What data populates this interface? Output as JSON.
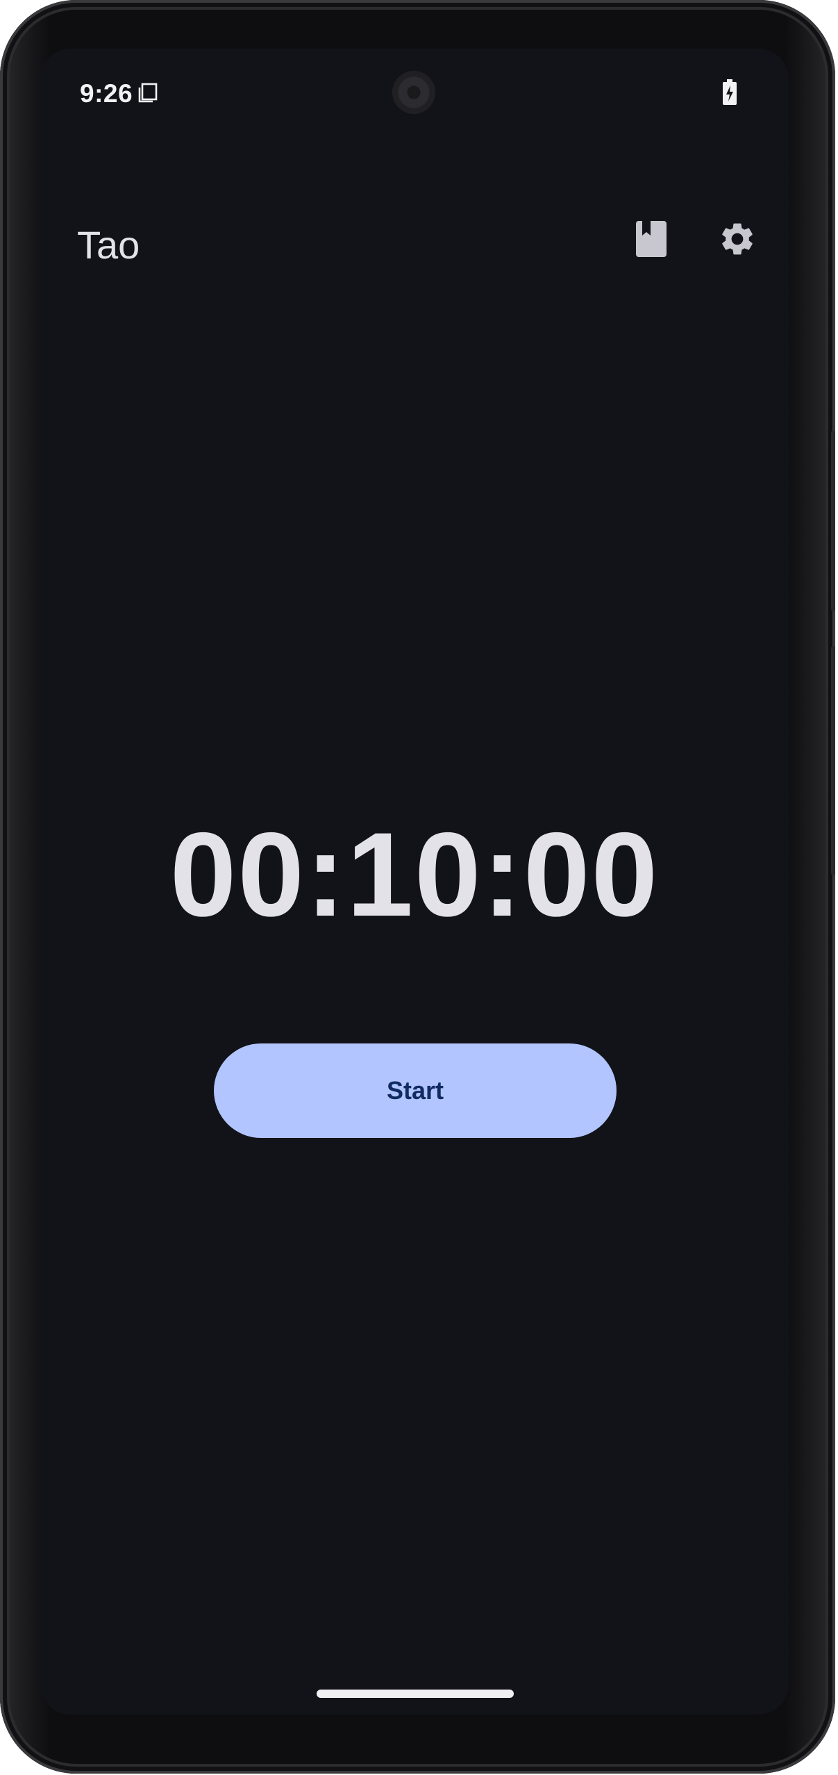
{
  "status_bar": {
    "time": "9:26",
    "icons": [
      "sim-card-icon",
      "battery-charging-icon"
    ]
  },
  "app_bar": {
    "title": "Tao",
    "actions": [
      {
        "icon": "bookmark-book-icon"
      },
      {
        "icon": "gear-icon"
      }
    ]
  },
  "timer": {
    "display": "00:10:00"
  },
  "controls": {
    "start_label": "Start"
  },
  "colors": {
    "background": "#121318",
    "on_surface": "#e3e2e8",
    "primary_container": "#b3c5ff",
    "on_primary_container": "#102b5f"
  }
}
